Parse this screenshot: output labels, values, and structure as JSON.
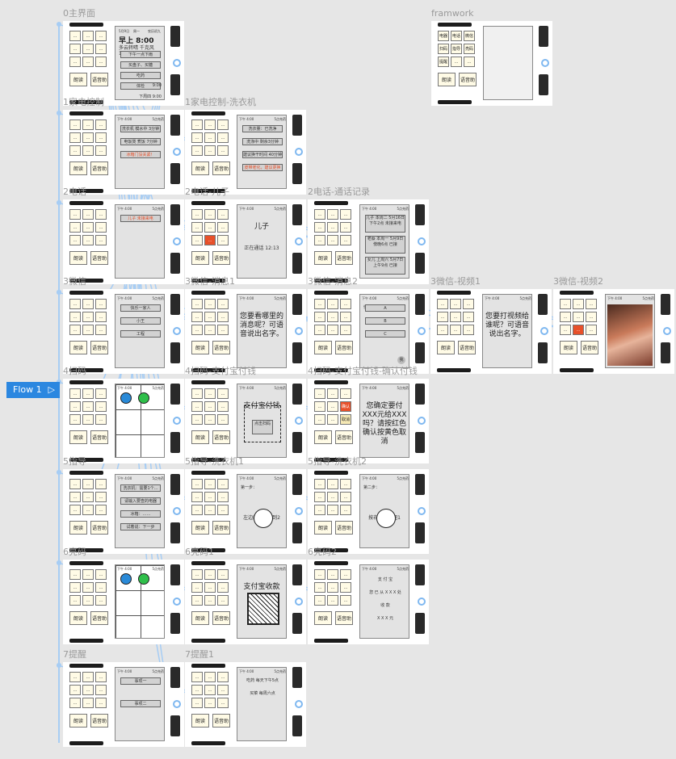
{
  "flow_button": {
    "label": "Flow 1",
    "icon": "play-triangle-icon"
  },
  "boards": [
    {
      "id": "home",
      "label": "0主界面",
      "screen": {
        "top": [
          "5月9日",
          "周一",
          "农历初九"
        ],
        "big": "早上 8:00",
        "sub": "多云转晴 千克风 12~20°C",
        "rows": [
          "下午一点下雨",
          "买盘子、买糖",
          "吃药",
          "体检"
        ],
        "right": [
          "9:00",
          "下周四 9:00"
        ]
      }
    },
    {
      "id": "framework",
      "label": "framwork",
      "keys": [
        "电器",
        "电话",
        "微信",
        "扫码",
        "指导",
        "亮码",
        "提醒",
        "…",
        "…",
        "朗读",
        "语音助手"
      ]
    },
    {
      "id": "appliance",
      "label": "1家电控制",
      "screen": {
        "rows": [
          "洗衣机 模水中 3分钟",
          "电饭煲 煮饭 7分钟",
          "冰箱门没关紧！"
        ]
      }
    },
    {
      "id": "washer",
      "label": "1家电控制-洗衣机",
      "screen": {
        "rows": [
          "洗衣量：已洗净",
          "洗涤中 剩余3分钟",
          "建议换干时间 40分钟",
          "皮带老化，建议更换"
        ]
      }
    },
    {
      "id": "phone",
      "label": "2电话",
      "screen": {
        "rows": [
          "儿子 未接来电"
        ]
      }
    },
    {
      "id": "phone-son",
      "label": "2电话-儿子",
      "screen": {
        "big": "儿子",
        "sub": "正在通话 12:13"
      }
    },
    {
      "id": "phone-log",
      "label": "2电话-通话记录",
      "screen": {
        "rows": [
          "儿子 本周二 5月16日 下午2点 未接来电",
          "老蔡 本周一 5月9日 傍晚6点 已接",
          "女儿 上周六 5月7日 上午9点 已接"
        ]
      }
    },
    {
      "id": "wechat",
      "label": "3微信",
      "screen": {
        "rows": [
          "快乐一家人",
          "小王",
          "工程"
        ]
      }
    },
    {
      "id": "wechat-msg1",
      "label": "3微信-消息1",
      "screen": {
        "big": "您要看哪里的消息呢？可语音说出名字。"
      }
    },
    {
      "id": "wechat-msg2",
      "label": "3微信-消息2",
      "screen": {
        "top": "快乐一家人（10）",
        "rows": [
          "A",
          "B",
          "C"
        ],
        "me": "我"
      }
    },
    {
      "id": "wechat-video1",
      "label": "3微信-视频1",
      "screen": {
        "big": "您要打视频给谁呢？可语音说出名字。"
      }
    },
    {
      "id": "wechat-video2",
      "label": "3微信-视频2",
      "screen": {
        "photo": "video-call-photo"
      }
    },
    {
      "id": "scan",
      "label": "4扫码"
    },
    {
      "id": "scan-pay",
      "label": "4扫码-支付宝付钱",
      "screen": {
        "big": "支付宝付钱",
        "btn": "点击扫码"
      }
    },
    {
      "id": "scan-confirm",
      "label": "4扫码-支付宝付钱-确认付钱",
      "screen": {
        "big": "您确定要付XXX元给XXX吗？请按红色确认按黄色取消"
      },
      "keys": [
        "确认",
        "取消"
      ]
    },
    {
      "id": "guide",
      "label": "5指导",
      "screen": {
        "rows": [
          "洗衣机：需要1个...",
          "请输入要查的电器",
          "冰箱：……",
          "试着说：下一步"
        ]
      }
    },
    {
      "id": "guide-w1",
      "label": "5指导-洗衣机1",
      "screen": {
        "top": "第一步：",
        "sub": "左边的旋钮旋到2"
      }
    },
    {
      "id": "guide-w2",
      "label": "5指导-洗衣机2",
      "screen": {
        "top": "第二步：",
        "sub": "按右边的按钮1"
      }
    },
    {
      "id": "code",
      "label": "6亮码"
    },
    {
      "id": "code1",
      "label": "6亮码1",
      "screen": {
        "big": "支付宝收款"
      }
    },
    {
      "id": "code2",
      "label": "6亮码2",
      "screen": {
        "rows": [
          "支 付 宝",
          "您 已 从 X X X 处",
          "收 款",
          "X X X 元"
        ]
      }
    },
    {
      "id": "remind",
      "label": "7提醒",
      "screen": {
        "rows": [
          "事项一",
          "事项二"
        ]
      }
    },
    {
      "id": "remind1",
      "label": "7提醒1",
      "screen": {
        "rows": [
          "吃药 每天下午5点",
          "买菜 每周六点"
        ]
      }
    }
  ],
  "status": {
    "time": "下午 4:00",
    "battery": "5点充药"
  },
  "keys": {
    "read": "朗读",
    "assistant": "语音助手",
    "dots": "…"
  },
  "colors": {
    "wire": "#a7cdf4",
    "flow": "#2b87e0",
    "key": "#fffbe6",
    "red": "#e8502a"
  }
}
